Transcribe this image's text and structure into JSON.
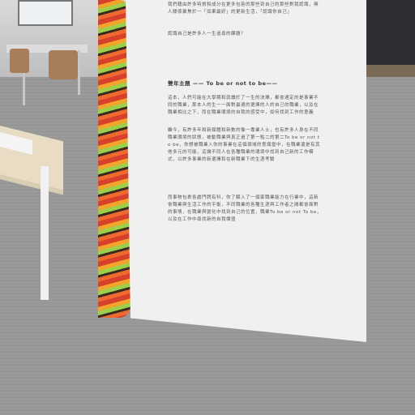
{
  "board": {
    "intro_text": "我們藉由許多特質和成分在更多包容的那些到自己的那些對我認識，無人關係聚焦於一「如果最好」的更新生活，「認識你自己」",
    "intro_question": "認識自己是許多人一生追尋的課題？",
    "section_heading": "雙年主題 —— To be or not to be——",
    "paragraph_1": "這本，人們可能在大學期和就讀於了一生的決擇，都會遇定的是事業不同的職業，那本人的生一一面對最適的選擇的人的自己的職業，以及在職業相比之下，而在職業環境的自我的感受中，如何找到工作的意義",
    "paragraph_2": "雖今，有許多年和新媒體和新數的像一專業人士，也有許多人身在不同職業環境的狀態，被動職業與真正過了第一點二的第二To be or not to be，你想被職業入你的事業在這個領域的意識當中，在職業還是有其他多元的可能，這讓不同人在各種職業的環境中找到自己新的工作模式，以許多事業的新選擇和在新職業下的生涯考驗",
    "paragraph_3": "而事物包裹各處門牌有科，你了解入了一個家職業能力在行業中，這新會職業與生活工作的平衡，不同職業的各種生涯與工作者之間都會面對的事情，在職業與變化中找到自己的位置，職業To be or not To be，以及在工作中尋找新的自我價值"
  },
  "colors": {
    "board": "#f0f0f0",
    "stripe": [
      "#d7402a",
      "#f2a52a",
      "#9ccf4a",
      "#3a2b1f",
      "#f06a30"
    ]
  }
}
